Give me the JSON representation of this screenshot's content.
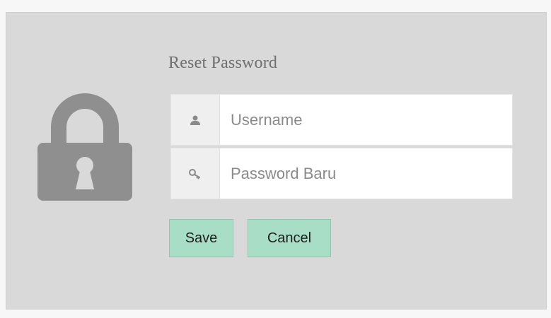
{
  "form": {
    "title": "Reset Password",
    "username": {
      "placeholder": "Username",
      "value": "",
      "icon": "user-icon"
    },
    "new_password": {
      "placeholder": "Password Baru",
      "value": "",
      "icon": "key-icon"
    }
  },
  "buttons": {
    "save_label": "Save",
    "cancel_label": "Cancel"
  },
  "decor": {
    "illustration": "padlock-icon"
  },
  "colors": {
    "panel_bg": "#d9d9d9",
    "button_bg": "#a9dec6",
    "icon_gray": "#8f8f8f"
  }
}
